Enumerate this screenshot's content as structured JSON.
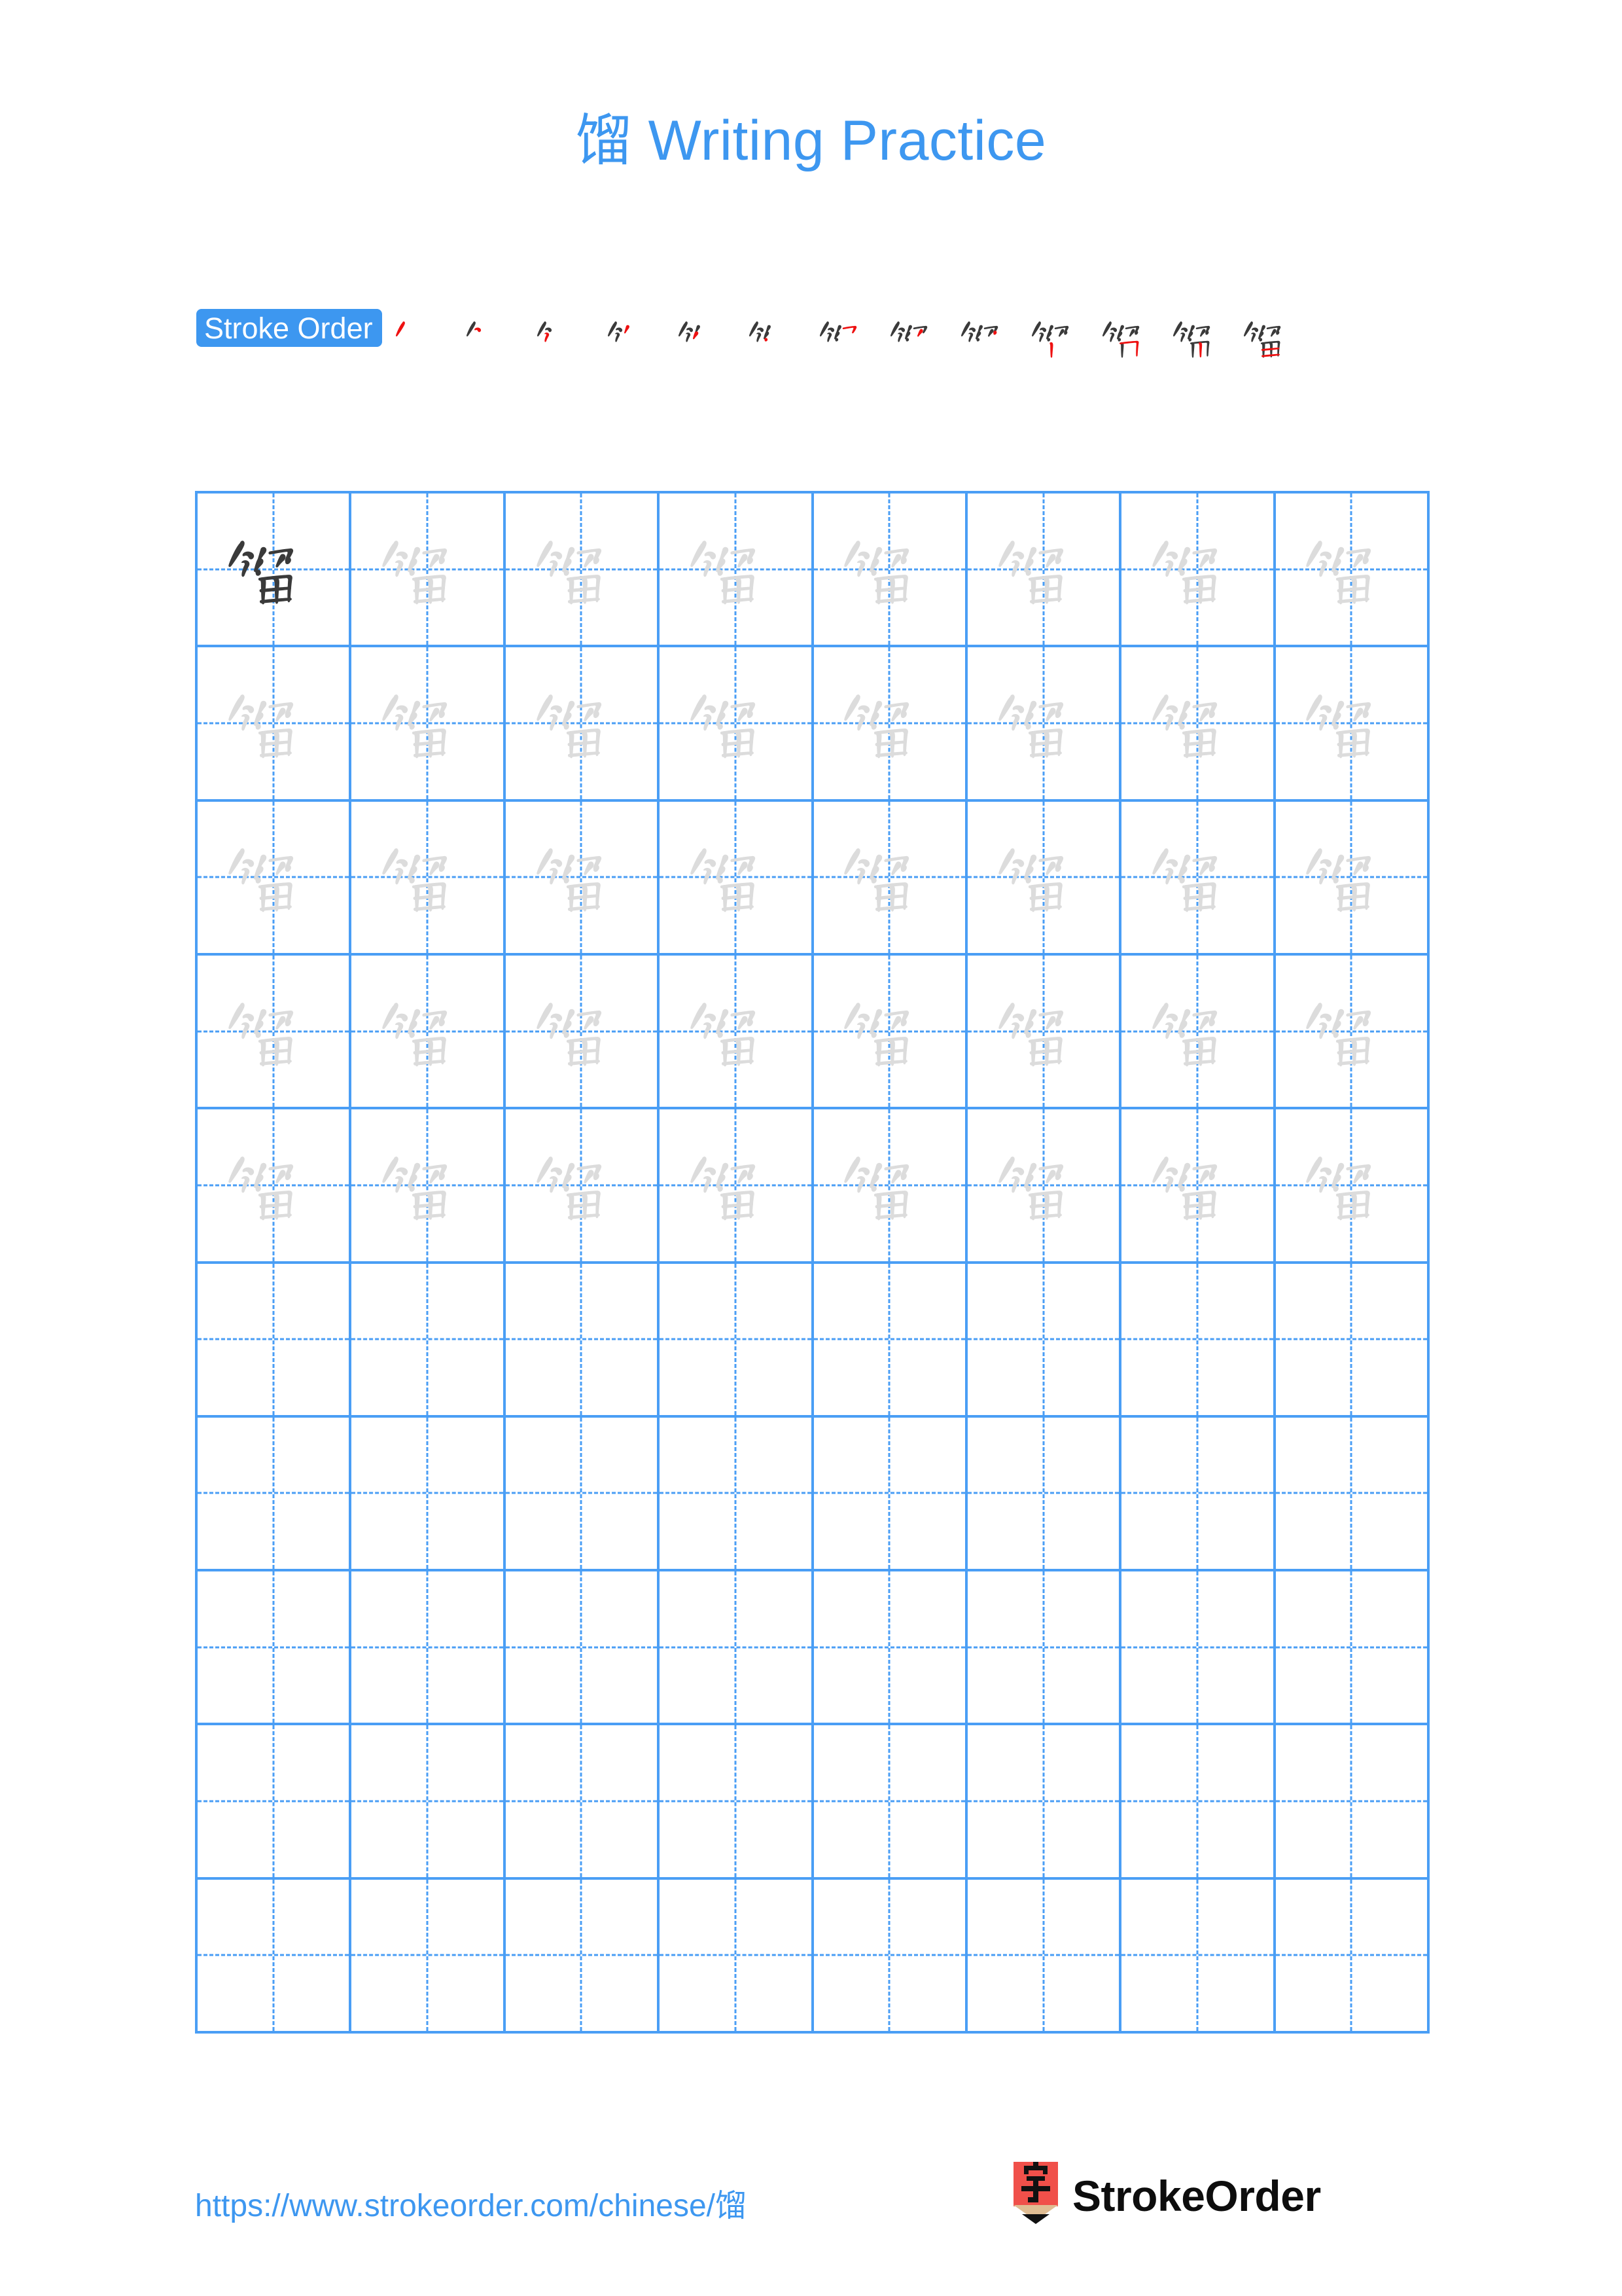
{
  "character": "馏",
  "title": {
    "character": "馏",
    "text": " Writing Practice",
    "full": "馏 Writing Practice",
    "color": "#3d97f0"
  },
  "stroke_order": {
    "badge_label": "Stroke Order",
    "badge_bg": "#3d97f0",
    "badge_text_color": "#ffffff",
    "total_strokes": 13,
    "new_stroke_color": "#ee1111",
    "old_stroke_color": "#3a3a3a",
    "steps": [
      {
        "index": 1,
        "strokes_shown": 1
      },
      {
        "index": 2,
        "strokes_shown": 2
      },
      {
        "index": 3,
        "strokes_shown": 3
      },
      {
        "index": 4,
        "strokes_shown": 4
      },
      {
        "index": 5,
        "strokes_shown": 5
      },
      {
        "index": 6,
        "strokes_shown": 6
      },
      {
        "index": 7,
        "strokes_shown": 7
      },
      {
        "index": 8,
        "strokes_shown": 8
      },
      {
        "index": 9,
        "strokes_shown": 9
      },
      {
        "index": 10,
        "strokes_shown": 10
      },
      {
        "index": 11,
        "strokes_shown": 11
      },
      {
        "index": 12,
        "strokes_shown": 12
      },
      {
        "index": 13,
        "strokes_shown": 13
      }
    ]
  },
  "practice_grid": {
    "columns": 8,
    "rows": 10,
    "grid_line_color": "#4a9ef5",
    "guide_line_color": "#4a9ef5",
    "dark_character_color": "#3a3a3a",
    "traced_character_color": "#dcdcdc",
    "cells": [
      [
        "dark",
        "trace",
        "trace",
        "trace",
        "trace",
        "trace",
        "trace",
        "trace"
      ],
      [
        "trace",
        "trace",
        "trace",
        "trace",
        "trace",
        "trace",
        "trace",
        "trace"
      ],
      [
        "trace",
        "trace",
        "trace",
        "trace",
        "trace",
        "trace",
        "trace",
        "trace"
      ],
      [
        "trace",
        "trace",
        "trace",
        "trace",
        "trace",
        "trace",
        "trace",
        "trace"
      ],
      [
        "trace",
        "trace",
        "trace",
        "trace",
        "trace",
        "trace",
        "trace",
        "trace"
      ],
      [
        "empty",
        "empty",
        "empty",
        "empty",
        "empty",
        "empty",
        "empty",
        "empty"
      ],
      [
        "empty",
        "empty",
        "empty",
        "empty",
        "empty",
        "empty",
        "empty",
        "empty"
      ],
      [
        "empty",
        "empty",
        "empty",
        "empty",
        "empty",
        "empty",
        "empty",
        "empty"
      ],
      [
        "empty",
        "empty",
        "empty",
        "empty",
        "empty",
        "empty",
        "empty",
        "empty"
      ],
      [
        "empty",
        "empty",
        "empty",
        "empty",
        "empty",
        "empty",
        "empty",
        "empty"
      ]
    ]
  },
  "footer": {
    "url": "https://www.strokeorder.com/chinese/馏",
    "url_color": "#3d97f0",
    "brand_name": "StrokeOrder",
    "logo_character": "字",
    "logo_body_color": "#f0504a",
    "logo_wood_color": "#e0bd93",
    "logo_tip_color": "#111111"
  }
}
